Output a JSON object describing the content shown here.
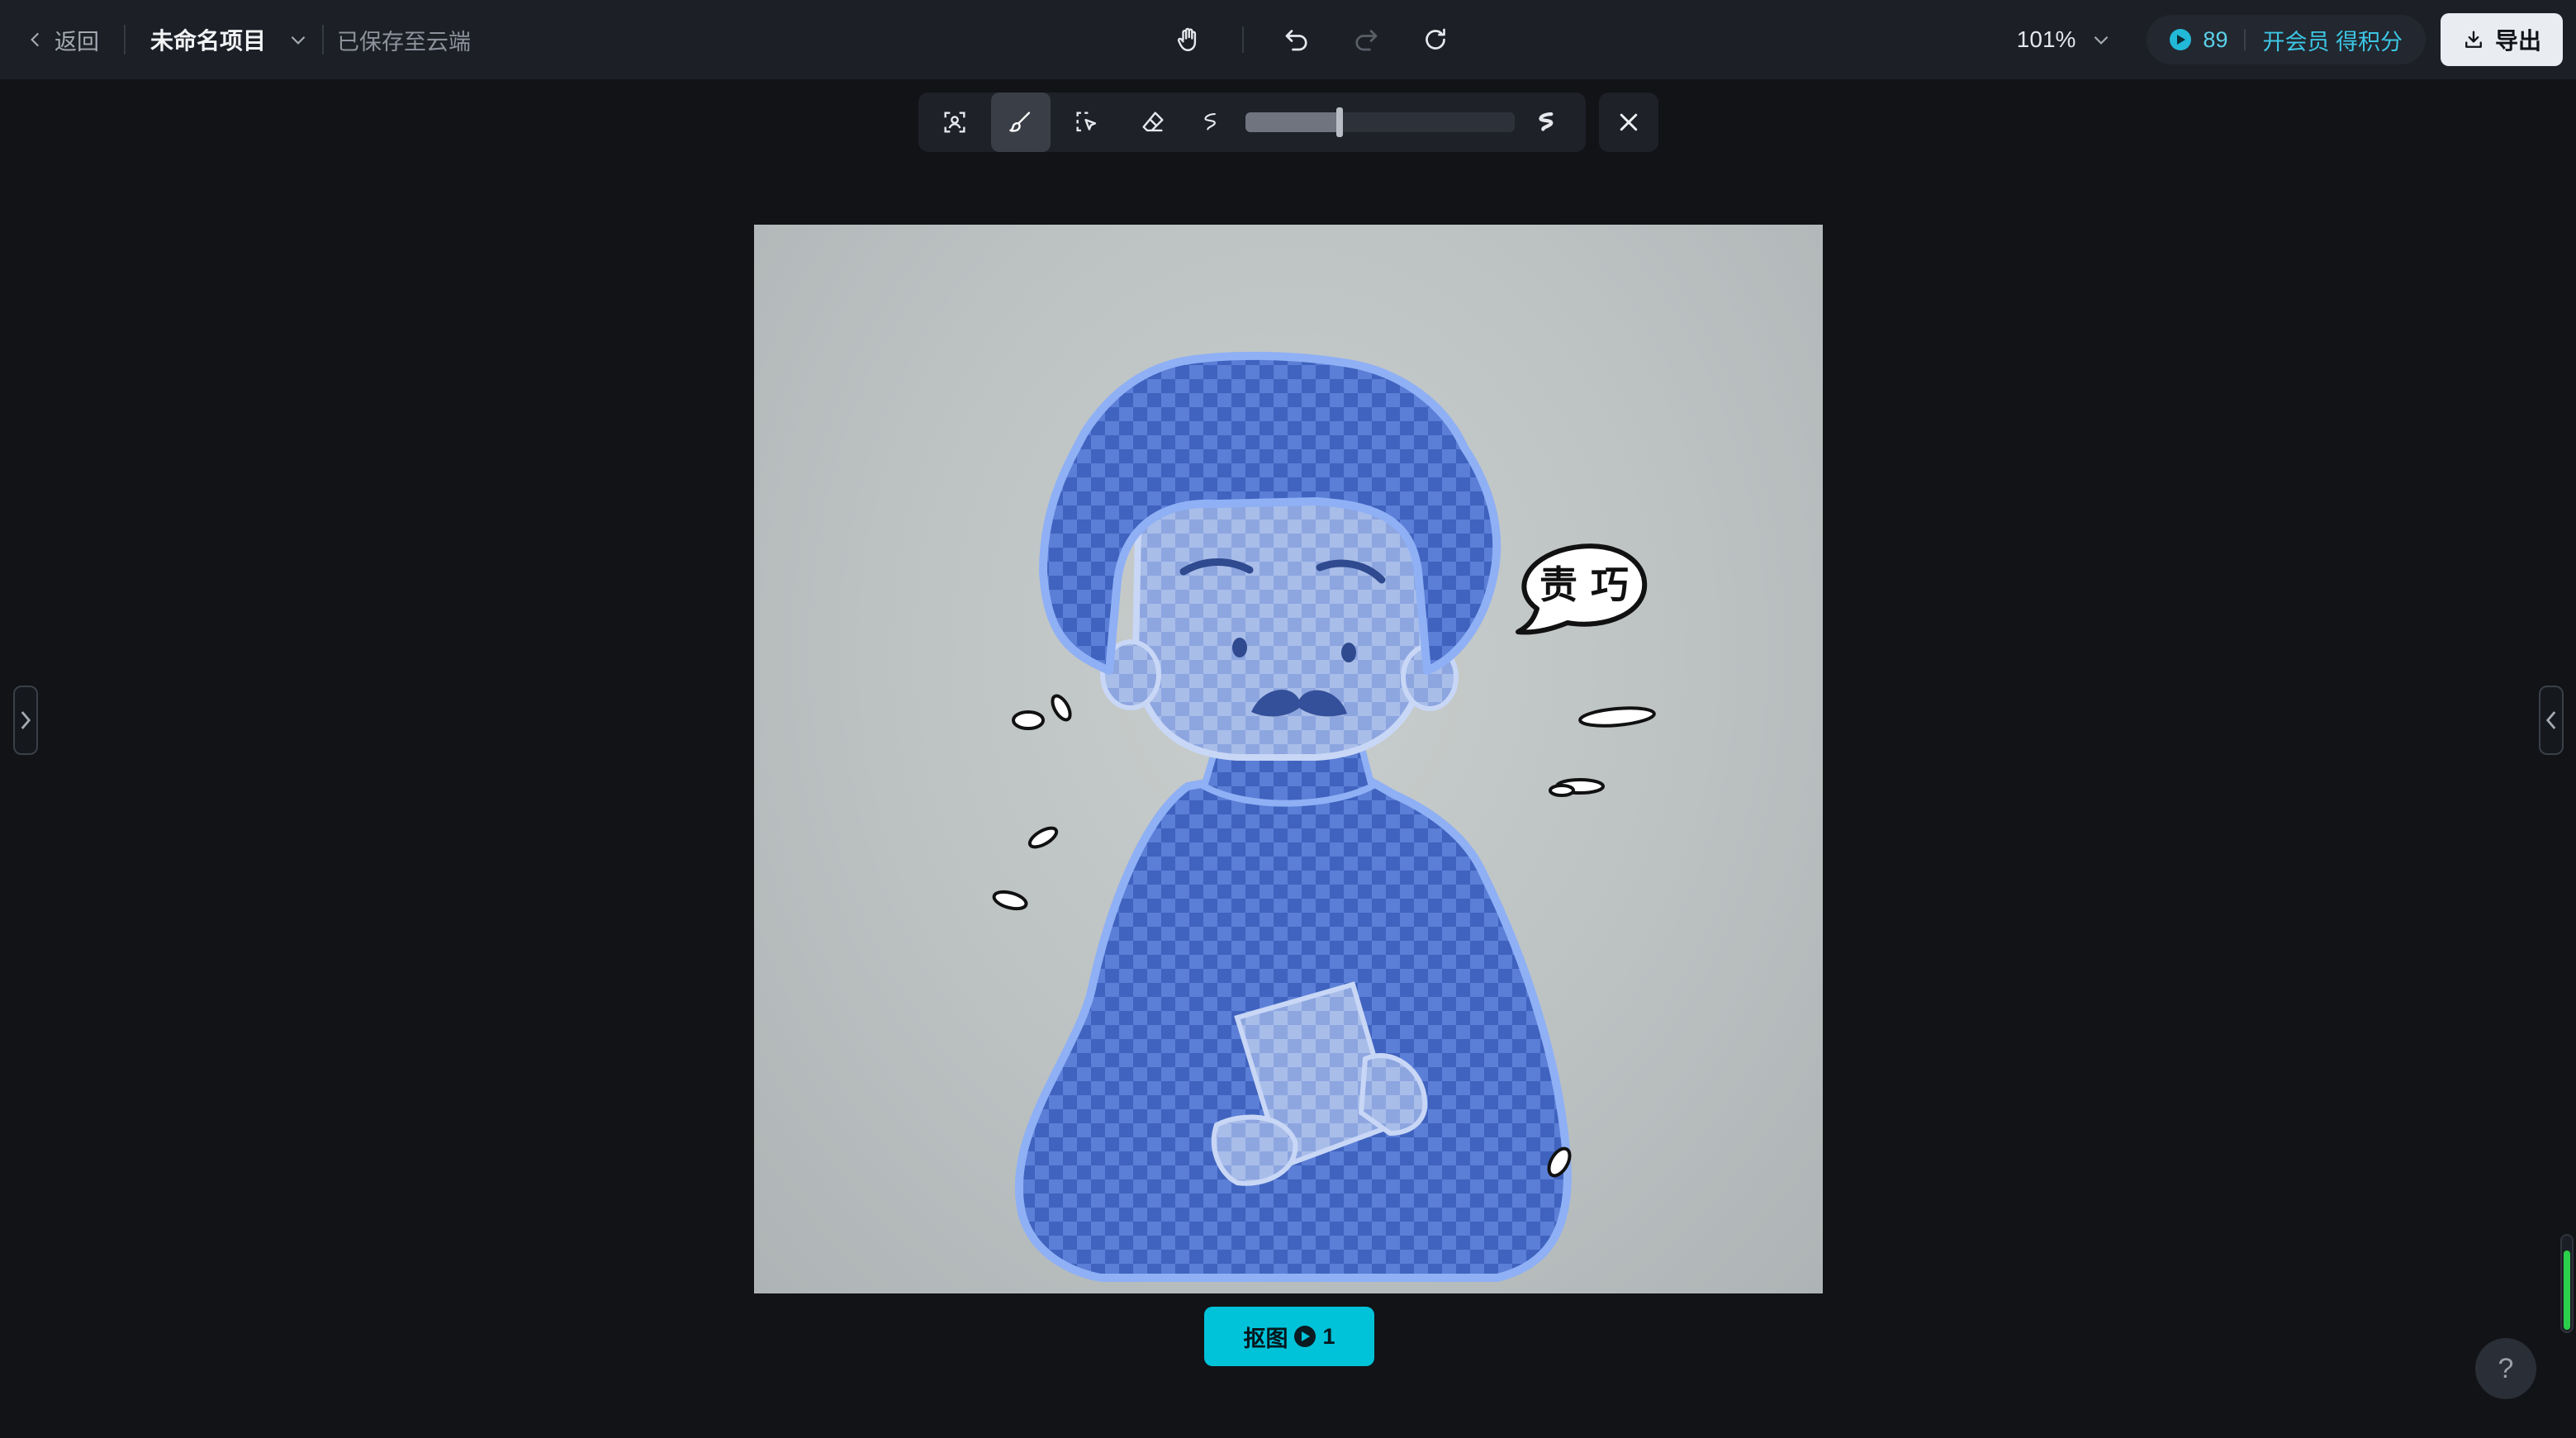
{
  "header": {
    "back_label": "返回",
    "project_name": "未命名项目",
    "save_status": "已保存至云端",
    "zoom": "101%",
    "credits": "89",
    "vip_link": "开会员 得积分",
    "export_label": "导出"
  },
  "toolbar": {
    "tools": [
      "portrait-select-icon",
      "brush-icon",
      "smart-select-icon",
      "eraser-icon"
    ],
    "active_tool": "brush-icon",
    "brush_size_percent": 35
  },
  "canvas": {
    "speech_bubble_text": "责 巧"
  },
  "action": {
    "cutout_label": "抠图",
    "cutout_cost": "1"
  },
  "help_label": "?",
  "colors": {
    "accent": "#00c2d9",
    "credit": "#3cc6e4",
    "mask": "#4a6fcf",
    "background": "#111317",
    "topbar": "#1c1f26"
  }
}
